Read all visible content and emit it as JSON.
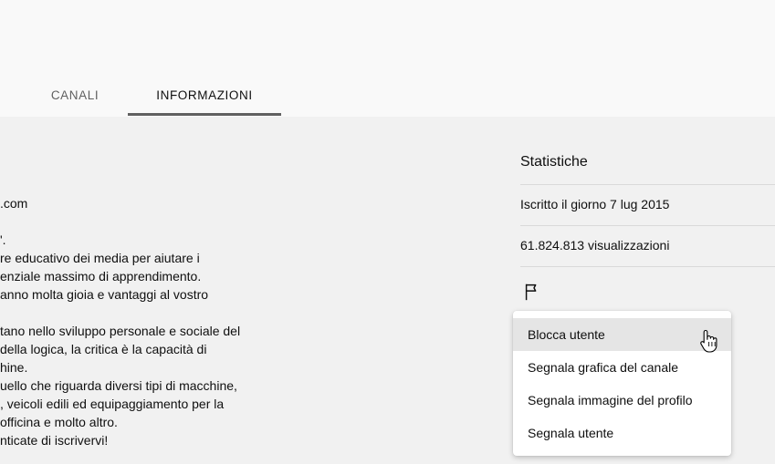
{
  "tabs": [
    {
      "label": "CANALI"
    },
    {
      "label": "INFORMAZIONI"
    }
  ],
  "description": {
    "lines": [
      ".com",
      "'.",
      "re educativo dei media per aiutare i",
      "enziale massimo di apprendimento.",
      "anno molta gioia e vantaggi al vostro",
      "tano nello sviluppo personale e sociale del",
      " della logica, la critica è la capacità di",
      "hine.",
      "uello che riguarda diversi tipi di macchine,",
      ", veicoli edili ed equipaggiamento per la",
      " officina e molto altro.",
      "nticate di iscrivervi!"
    ]
  },
  "stats": {
    "title": "Statistiche",
    "joined": "Iscritto il giorno 7 lug 2015",
    "views": "61.824.813 visualizzazioni"
  },
  "menu": {
    "items": [
      {
        "label": "Blocca utente"
      },
      {
        "label": "Segnala grafica del canale"
      },
      {
        "label": "Segnala immagine del profilo"
      },
      {
        "label": "Segnala utente"
      }
    ]
  },
  "icons": {
    "flag": "flag-icon",
    "cursor": "hand-pointer-cursor"
  },
  "colors": {
    "page_bg": "#f9f9f9",
    "content_bg": "#f1f1f1",
    "tab_underline": "#606060",
    "menu_hover": "#e5e5e5"
  }
}
